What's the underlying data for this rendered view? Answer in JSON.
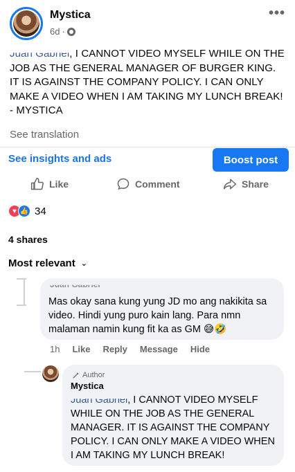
{
  "post": {
    "page_name": "Mystica",
    "time": "6d",
    "mention_prefix": "Juan Gabriel",
    "body": ", I CANNOT VIDEO MYSELF WHILE ON THE JOB AS THE GENERAL MANAGER OF BURGER KING. IT IS AGAINST THE COMPANY POLICY. I CAN ONLY MAKE A VIDEO WHEN I AM TAKING MY LUNCH BREAK! - MYSTICA",
    "see_translation": "See translation",
    "more_icon": "more-horizontal-icon"
  },
  "insights": {
    "link": "See insights and ads",
    "boost": "Boost post"
  },
  "actions": {
    "like": "Like",
    "comment": "Comment",
    "share": "Share"
  },
  "stats": {
    "reaction_count": "34",
    "shares": "4 shares"
  },
  "sort": {
    "label": "Most relevant"
  },
  "comments": [
    {
      "author": "Juan Gabriel",
      "text": "Mas okay sana kung yung JD mo ang nakikita sa video. Hindi yung puro kain lang. Para nmn malaman namin kung fit ka as GM 😅🤣",
      "time": "1h",
      "actions": [
        "Like",
        "Reply",
        "Message",
        "Hide"
      ]
    }
  ],
  "reply": {
    "badge": "Author",
    "author": "Mystica",
    "mention_prefix": "Juan Gabriel",
    "text": ", I CANNOT VIDEO MYSELF WHILE ON THE JOB AS THE GENERAL MANAGER. IT IS AGAINST THE COMPANY POLICY. I CAN ONLY MAKE A VIDEO WHEN I AM TAKING MY LUNCH BREAK!"
  },
  "colors": {
    "accent": "#1877f2",
    "love": "#f33e58",
    "muted": "#65676b"
  }
}
